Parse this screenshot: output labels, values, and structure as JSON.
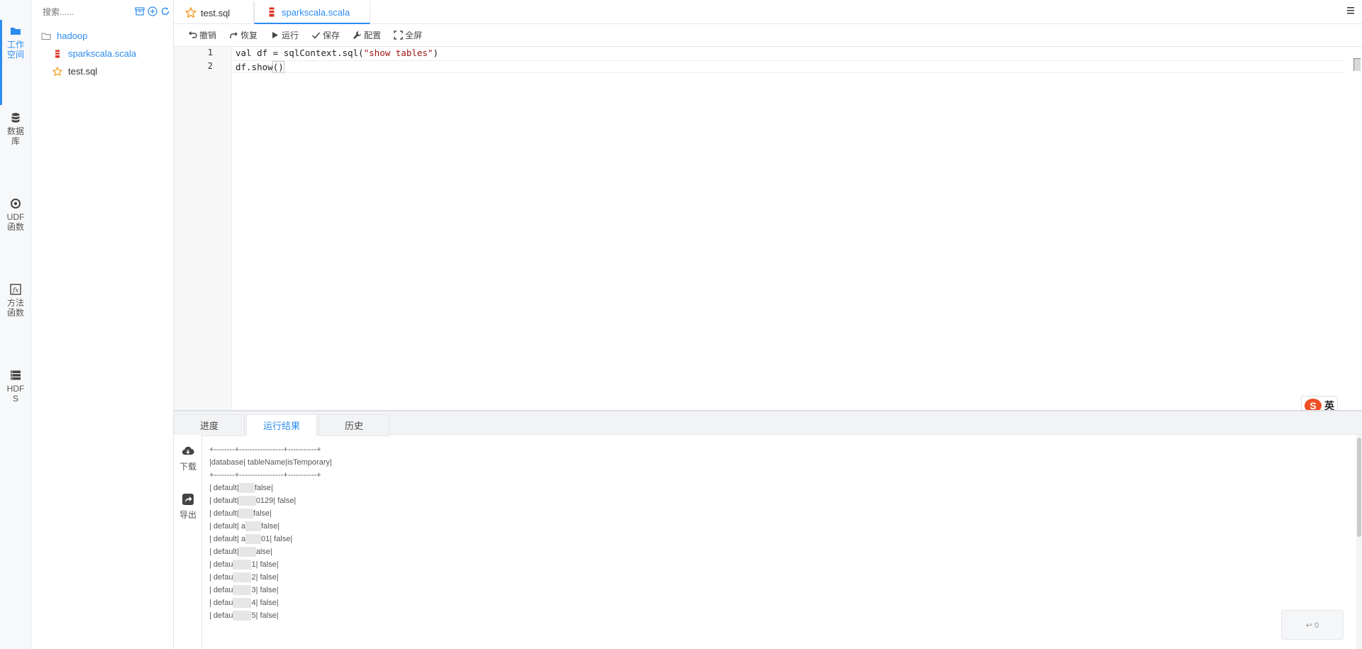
{
  "nav": {
    "workspace": "工作空间",
    "database": "数据库",
    "udf": "UDF函数",
    "methods": "方法函数",
    "hdfs": "HDFS"
  },
  "tree": {
    "search_placeholder": "搜索......",
    "folder": "hadoop",
    "files": [
      "sparkscala.scala",
      "test.sql"
    ]
  },
  "tabs": [
    "test.sql",
    "sparkscala.scala"
  ],
  "toolbar": {
    "undo": "撤销",
    "redo": "恢复",
    "run": "运行",
    "save": "保存",
    "config": "配置",
    "fullscreen": "全屏"
  },
  "editor": {
    "line_numbers": [
      "1",
      "2"
    ],
    "line1_prefix": "val df = sqlContext.sql(",
    "line1_string": "\"show tables\"",
    "line1_suffix": ")",
    "line2_prefix": "df.show",
    "line2_paren": "()"
  },
  "ime": {
    "logo": "S",
    "mode": "英"
  },
  "result_tabs": [
    "进度",
    "运行结果",
    "历史"
  ],
  "result_side": {
    "download": "下载",
    "export": "导出"
  },
  "result_output": {
    "border": "+--------+-----------------+-----------+",
    "header": "|database| tableName|isTemporary|",
    "rows": [
      {
        "pre": "| default|",
        "post": "false|"
      },
      {
        "pre": "| default|",
        "post": "0129| false|"
      },
      {
        "pre": "| default|",
        "post": "false|"
      },
      {
        "pre": "| default| a",
        "post": "false|"
      },
      {
        "pre": "| default| a",
        "post": "01| false|"
      },
      {
        "pre": "| default|",
        "post": "alse|"
      },
      {
        "pre": "| defau",
        "post": "1| false|"
      },
      {
        "pre": "| defau",
        "post": "2| false|"
      },
      {
        "pre": "| defau",
        "post": "3| false|"
      },
      {
        "pre": "| defau",
        "post": "4| false|"
      },
      {
        "pre": "| defau",
        "post": "5| false|"
      }
    ]
  },
  "count_badge": "↩ 0",
  "colors": {
    "accent": "#2d8cf0",
    "string": "#a31515"
  }
}
